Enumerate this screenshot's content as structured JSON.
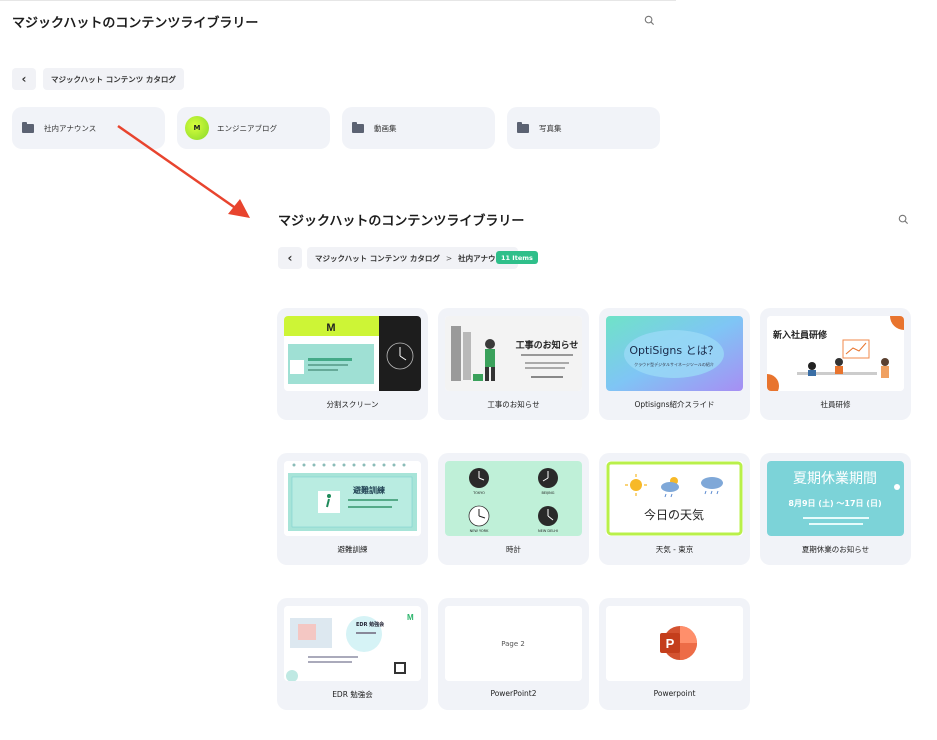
{
  "top": {
    "title": "マジックハットのコンテンツライブラリー",
    "breadcrumb": "マジックハット コンテンツ カタログ",
    "folders": [
      {
        "label": "社内アナウンス",
        "icon": "folder-icon"
      },
      {
        "label": "エンジニアブログ",
        "icon": "blog-avatar-icon"
      },
      {
        "label": "動画集",
        "icon": "folder-icon"
      },
      {
        "label": "写真集",
        "icon": "folder-icon"
      }
    ]
  },
  "bottom": {
    "title": "マジックハットのコンテンツライブラリー",
    "breadcrumb_root": "マジックハット コンテンツ カタログ",
    "breadcrumb_sep": ">",
    "breadcrumb_current": "社内アナウンス",
    "badge": "11 Items",
    "cards": [
      {
        "label": "分割スクリーン"
      },
      {
        "label": "工事のお知らせ"
      },
      {
        "label": "Optisigns紹介スライド"
      },
      {
        "label": "社員研修"
      },
      {
        "label": "避難訓練"
      },
      {
        "label": "時計"
      },
      {
        "label": "天気 - 東京"
      },
      {
        "label": "夏期休業のお知らせ"
      },
      {
        "label": "EDR 勉強会"
      },
      {
        "label": "PowerPoint2"
      },
      {
        "label": "Powerpoint"
      }
    ]
  },
  "thumbs": {
    "logo_letter": "M",
    "evac_title": "避難訓練",
    "construction_title": "工事のお知らせ",
    "optisigns_title": "OptiSigns とは？",
    "optisigns_sub": "クラウド型デジタルサイネージツールの紹介",
    "training_title": "新入社員研修",
    "clock_cities": [
      "TOKYO",
      "BEIJING",
      "NEW YORK",
      "NEW DELHI"
    ],
    "weather_text": "今日の天気",
    "summer_title": "夏期休業期間",
    "summer_dates": "8月9日 (土) ～17日 (日)",
    "edr_title": "EDR 勉強会",
    "page2_text": "Page 2",
    "ppt_letter": "P"
  },
  "colors": {
    "arrow": "#e8442e",
    "badge": "#2fbf8a",
    "card_bg": "#f1f3f8"
  }
}
